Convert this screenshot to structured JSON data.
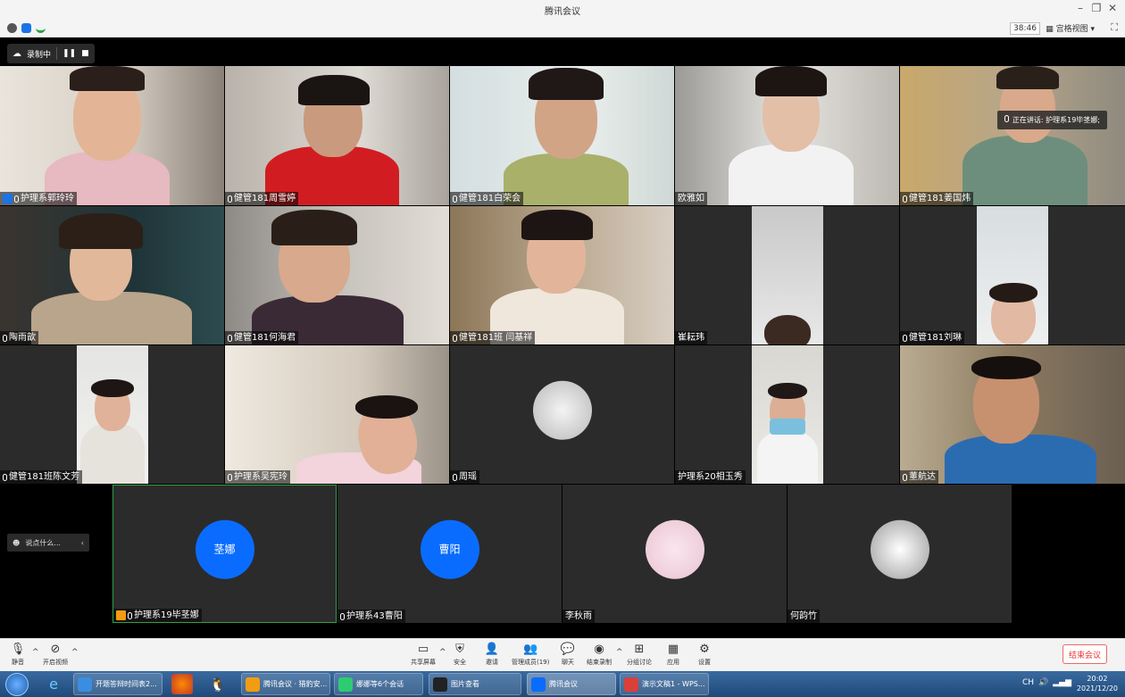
{
  "window": {
    "title": "腾讯会议",
    "minimize": "–",
    "restore": "❐",
    "close": "✕"
  },
  "infobar": {
    "timer": "38:46",
    "view": "宫格视图"
  },
  "recording": {
    "label": "录制中"
  },
  "speaking": {
    "text": "正在讲话: 护理系19毕茎娜;"
  },
  "tiles": [
    {
      "name": "护理系郭玲玲"
    },
    {
      "name": "健管181周雪婷"
    },
    {
      "name": "健管181白荣会"
    },
    {
      "name": "欧雅如"
    },
    {
      "name": "健管181姜国炜"
    },
    {
      "name": "陶雨歆"
    },
    {
      "name": "健管181何海君"
    },
    {
      "name": "健管181班 闫基祥"
    },
    {
      "name": "崔耘玮"
    },
    {
      "name": "健管181刘琳"
    },
    {
      "name": "健管181班陈文芳"
    },
    {
      "name": "护理系吴宪玲"
    },
    {
      "name": "周瑶"
    },
    {
      "name": "护理系20相玉秀"
    },
    {
      "name": "董航达"
    },
    {
      "name": "护理系19毕茎娜",
      "avatar": "茎娜"
    },
    {
      "name": "护理系43曹阳",
      "avatar": "曹阳"
    },
    {
      "name": "李秋雨"
    },
    {
      "name": "何韵竹"
    }
  ],
  "chat": {
    "placeholder": "说点什么..."
  },
  "toolbar": {
    "mute": "静音",
    "video": "开启视频",
    "share": "共享屏幕",
    "security": "安全",
    "invite": "邀请",
    "members": "管理成员(19)",
    "chat": "聊天",
    "record": "结束录制",
    "breakout": "分组讨论",
    "apps": "应用",
    "settings": "设置",
    "end": "结束会议"
  },
  "taskbar": {
    "items": [
      "开题答辩时间表2...",
      "腾讯会议 · 猎豹安...",
      "娜娜等6个会话",
      "图片查看",
      "腾讯会议",
      "演示文稿1 - WPS..."
    ],
    "tray": "CH",
    "time": "20:02",
    "date": "2021/12/20"
  },
  "colors": {
    "accent": "#0a6cff",
    "stage": "#000000",
    "tile": "#2b2b2b"
  }
}
